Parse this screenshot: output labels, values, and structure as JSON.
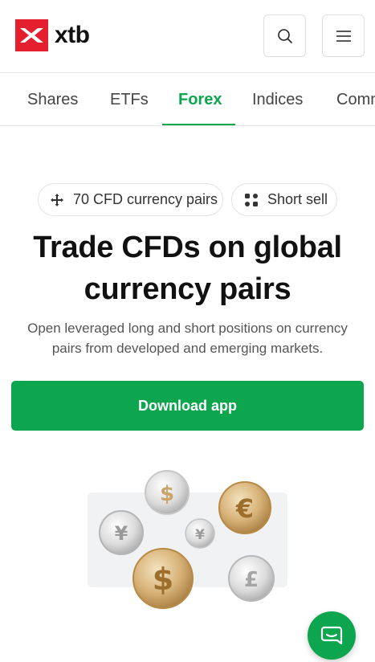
{
  "header": {
    "logo_text": "xtb",
    "search_icon": "search-icon",
    "menu_icon": "hamburger-menu-icon",
    "brand_color": "#e4202e"
  },
  "tabs": [
    {
      "label": "Shares",
      "active": false
    },
    {
      "label": "ETFs",
      "active": false
    },
    {
      "label": "Forex",
      "active": true
    },
    {
      "label": "Indices",
      "active": false
    },
    {
      "label": "Comm",
      "active": false
    }
  ],
  "chips": [
    {
      "label": "70 CFD currency pairs",
      "icon": "arrows-cross-icon"
    },
    {
      "label": "Short sell",
      "icon": "grid-dots-icon"
    }
  ],
  "hero": {
    "title_line1": "Trade CFDs on global",
    "title_line2": "currency pairs",
    "subtitle_line1": "Open leveraged long and short positions on currency",
    "subtitle_line2": "pairs from developed and emerging markets.",
    "cta_label": "Download app"
  },
  "colors": {
    "accent": "#0ea54f",
    "text": "#111111",
    "muted": "#555555"
  },
  "chat": {
    "icon": "chat-icon"
  }
}
